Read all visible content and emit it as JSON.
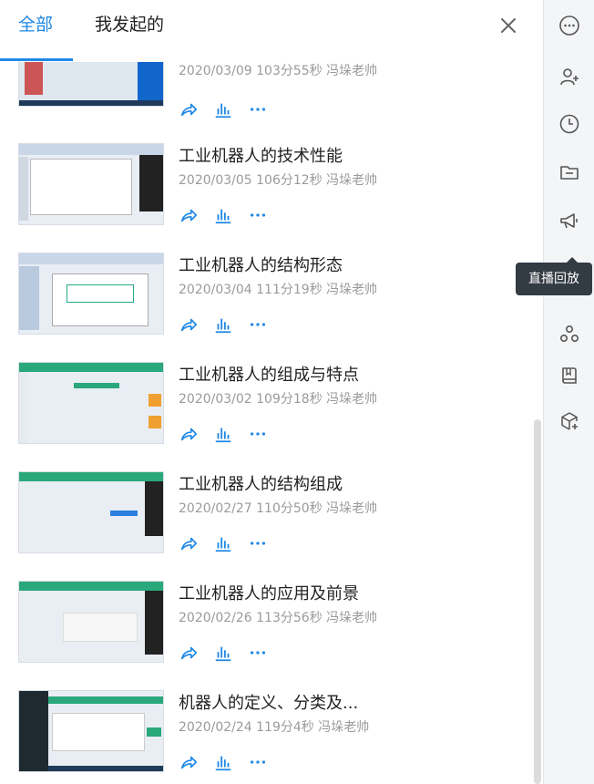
{
  "tabs": [
    {
      "label": "全部",
      "active": true
    },
    {
      "label": "我发起的",
      "active": false
    }
  ],
  "items": [
    {
      "title": "",
      "date": "2020/03/09",
      "duration": "103分55秒",
      "teacher": "冯垛老帅",
      "thumb": "desktop"
    },
    {
      "title": "工业机器人的技术性能",
      "date": "2020/03/05",
      "duration": "106分12秒",
      "teacher": "冯垛老帅",
      "thumb": "doc"
    },
    {
      "title": "工业机器人的结构形态",
      "date": "2020/03/04",
      "duration": "111分19秒",
      "teacher": "冯垛老帅",
      "thumb": "ppt"
    },
    {
      "title": "工业机器人的组成与特点",
      "date": "2020/03/02",
      "duration": "109分18秒",
      "teacher": "冯垛老帅",
      "thumb": "web"
    },
    {
      "title": "工业机器人的结构组成",
      "date": "2020/02/27",
      "duration": "110分50秒",
      "teacher": "冯垛老帅",
      "thumb": "chat"
    },
    {
      "title": "工业机器人的应用及前景",
      "date": "2020/02/26",
      "duration": "113分56秒",
      "teacher": "冯垛老帅",
      "thumb": "chat2"
    },
    {
      "title": "机器人的定义、分类及...",
      "date": "2020/02/24",
      "duration": "119分4秒",
      "teacher": "冯垛老帅",
      "thumb": "dark"
    }
  ],
  "rail": {
    "icons": [
      "more-icon",
      "add-member-icon",
      "history-icon",
      "folder-icon",
      "announcement-icon",
      "close-icon",
      "group-icon",
      "book-icon",
      "package-add-icon"
    ]
  },
  "tooltip": {
    "text": "直播回放"
  },
  "colors": {
    "accent": "#1e88e5",
    "meta": "#9a9a9a",
    "rail_bg": "#f4f5f7",
    "tooltip_bg": "#333b43"
  }
}
